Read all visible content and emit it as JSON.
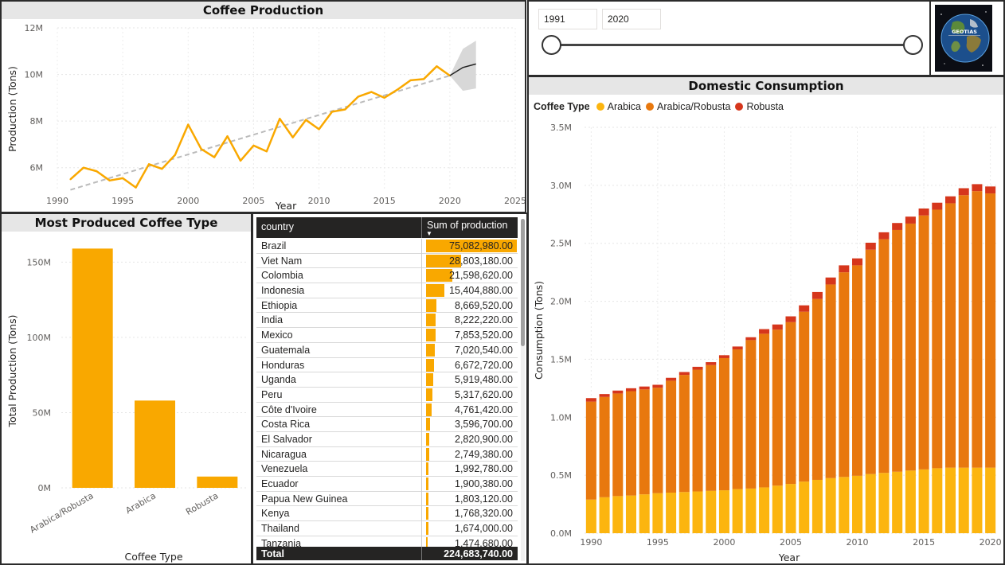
{
  "colors": {
    "primary": "#f9a800",
    "arabica": "#fcb50f",
    "arabica_robusta": "#e8780e",
    "robusta": "#d6361c",
    "forecast": "#222222",
    "trend": "#bbbbbb"
  },
  "icons": {
    "logo": "globe-icon"
  },
  "slicer": {
    "start": "1991",
    "end": "2020",
    "range": [
      1991,
      2020
    ]
  },
  "logo": {
    "text": "GEOTIAS"
  },
  "production_chart": {
    "title": "Coffee Production"
  },
  "type_chart": {
    "title": "Most Produced Coffee Type"
  },
  "consumption_chart": {
    "title": "Domestic Consumption"
  },
  "chart_data": [
    {
      "type": "line",
      "title": "Coffee Production",
      "xlabel": "Year",
      "ylabel": "Production (Tons)",
      "xlim": [
        1990,
        2025
      ],
      "ylim": [
        5000000,
        12000000
      ],
      "xticks": [
        "1990",
        "1995",
        "2000",
        "2005",
        "2010",
        "2015",
        "2020",
        "2025"
      ],
      "yticks": [
        "6M",
        "8M",
        "10M",
        "12M"
      ],
      "ytick_values": [
        6000000,
        8000000,
        10000000,
        12000000
      ],
      "grid": true,
      "series": [
        {
          "x": [
            1991,
            1992,
            1993,
            1994,
            1995,
            1996,
            1997,
            1998,
            1999,
            2000,
            2001,
            2002,
            2003,
            2004,
            2005,
            2006,
            2007,
            2008,
            2009,
            2010,
            2011,
            2012,
            2013,
            2014,
            2015,
            2016,
            2017,
            2018,
            2019,
            2020
          ],
          "values": [
            5500000,
            6000000,
            5850000,
            5450000,
            5550000,
            5150000,
            6150000,
            5950000,
            6550000,
            7850000,
            6800000,
            6450000,
            7350000,
            6300000,
            6950000,
            6700000,
            8100000,
            7300000,
            8050000,
            7650000,
            8400000,
            8500000,
            9050000,
            9250000,
            9000000,
            9350000,
            9750000,
            9800000,
            10350000,
            9950000
          ]
        }
      ],
      "trend": {
        "x": [
          1991,
          2020
        ],
        "values": [
          5050000,
          9950000
        ]
      },
      "forecast": {
        "x": [
          2020,
          2021,
          2022
        ],
        "values": [
          9950000,
          10300000,
          10450000
        ],
        "upper": [
          9950000,
          11100000,
          11450000
        ],
        "lower": [
          9950000,
          9300000,
          9400000
        ]
      }
    },
    {
      "type": "bar",
      "title": "Most Produced Coffee Type",
      "xlabel": "Coffee Type",
      "ylabel": "Total Production (Tons)",
      "categories": [
        "Arabica/Robusta",
        "Arabica",
        "Robusta"
      ],
      "values": [
        159000000,
        58000000,
        7500000
      ],
      "ylim": [
        0,
        165000000
      ],
      "yticks": [
        "0M",
        "50M",
        "100M",
        "150M"
      ],
      "ytick_values": [
        0,
        50000000,
        100000000,
        150000000
      ],
      "grid": true
    },
    {
      "type": "table",
      "columns": [
        "country",
        "Sum of production"
      ],
      "rows": [
        [
          "Brazil",
          "75,082,980.00",
          75082980
        ],
        [
          "Viet Nam",
          "28,803,180.00",
          28803180
        ],
        [
          "Colombia",
          "21,598,620.00",
          21598620
        ],
        [
          "Indonesia",
          "15,404,880.00",
          15404880
        ],
        [
          "Ethiopia",
          "8,669,520.00",
          8669520
        ],
        [
          "India",
          "8,222,220.00",
          8222220
        ],
        [
          "Mexico",
          "7,853,520.00",
          7853520
        ],
        [
          "Guatemala",
          "7,020,540.00",
          7020540
        ],
        [
          "Honduras",
          "6,672,720.00",
          6672720
        ],
        [
          "Uganda",
          "5,919,480.00",
          5919480
        ],
        [
          "Peru",
          "5,317,620.00",
          5317620
        ],
        [
          "Côte d'Ivoire",
          "4,761,420.00",
          4761420
        ],
        [
          "Costa Rica",
          "3,596,700.00",
          3596700
        ],
        [
          "El Salvador",
          "2,820,900.00",
          2820900
        ],
        [
          "Nicaragua",
          "2,749,380.00",
          2749380
        ],
        [
          "Venezuela",
          "1,992,780.00",
          1992780
        ],
        [
          "Ecuador",
          "1,900,380.00",
          1900380
        ],
        [
          "Papua New Guinea",
          "1,803,120.00",
          1803120
        ],
        [
          "Kenya",
          "1,768,320.00",
          1768320
        ],
        [
          "Thailand",
          "1,674,000.00",
          1674000
        ],
        [
          "Tanzania",
          "1,474,680.00",
          1474680
        ]
      ],
      "total_label": "Total",
      "total": "224,683,740.00"
    },
    {
      "type": "bar",
      "stacked": true,
      "title": "Domestic Consumption",
      "legend_title": "Coffee Type",
      "legend": "top-left",
      "xlabel": "Year",
      "ylabel": "Consumption (Tons)",
      "xticks": [
        "1990",
        "1995",
        "2000",
        "2005",
        "2010",
        "2015",
        "2020"
      ],
      "xlim": [
        1989.5,
        2020.5
      ],
      "yticks": [
        "0.0M",
        "0.5M",
        "1.0M",
        "1.5M",
        "2.0M",
        "2.5M",
        "3.0M",
        "3.5M"
      ],
      "ytick_values": [
        0,
        500000,
        1000000,
        1500000,
        2000000,
        2500000,
        3000000,
        3500000
      ],
      "ylim": [
        0,
        3500000
      ],
      "grid": true,
      "categories": [
        1990,
        1991,
        1992,
        1993,
        1994,
        1995,
        1996,
        1997,
        1998,
        1999,
        2000,
        2001,
        2002,
        2003,
        2004,
        2005,
        2006,
        2007,
        2008,
        2009,
        2010,
        2011,
        2012,
        2013,
        2014,
        2015,
        2016,
        2017,
        2018,
        2019,
        2020
      ],
      "series": [
        {
          "name": "Arabica",
          "values": [
            290000,
            310000,
            320000,
            325000,
            335000,
            345000,
            350000,
            355000,
            360000,
            365000,
            370000,
            380000,
            385000,
            395000,
            410000,
            425000,
            445000,
            460000,
            475000,
            485000,
            495000,
            510000,
            520000,
            530000,
            540000,
            550000,
            560000,
            565000,
            565000,
            565000,
            565000
          ]
        },
        {
          "name": "Arabica/Robusta",
          "values": [
            845000,
            865000,
            885000,
            900000,
            905000,
            910000,
            965000,
            1010000,
            1050000,
            1085000,
            1140000,
            1205000,
            1280000,
            1325000,
            1345000,
            1395000,
            1465000,
            1560000,
            1670000,
            1765000,
            1815000,
            1935000,
            2015000,
            2085000,
            2130000,
            2190000,
            2230000,
            2280000,
            2350000,
            2385000,
            2365000
          ]
        },
        {
          "name": "Robusta",
          "values": [
            30000,
            25000,
            25000,
            25000,
            25000,
            25000,
            25000,
            25000,
            25000,
            25000,
            25000,
            25000,
            25000,
            40000,
            45000,
            50000,
            55000,
            60000,
            60000,
            60000,
            60000,
            60000,
            60000,
            60000,
            60000,
            60000,
            60000,
            60000,
            60000,
            60000,
            60000
          ]
        }
      ]
    }
  ]
}
